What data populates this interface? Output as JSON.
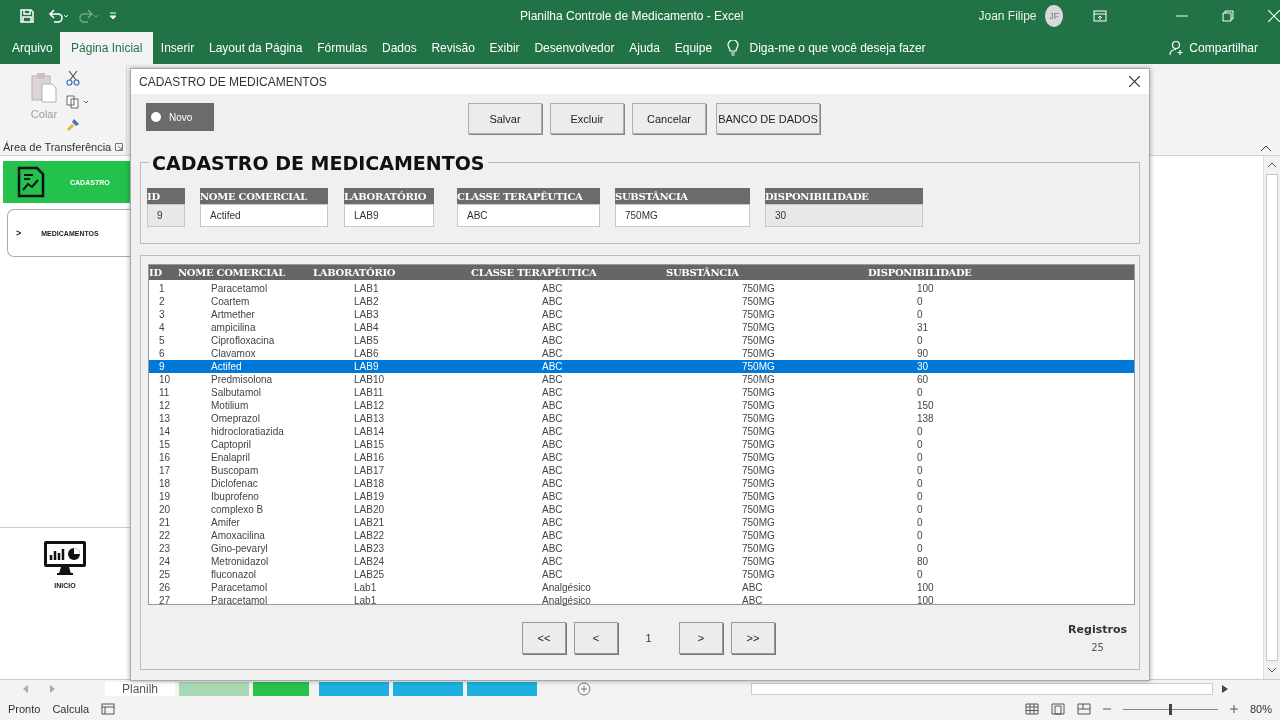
{
  "excel": {
    "title": "Planilha Controle de Medicamento  -  Excel",
    "user": "Joan Filipe",
    "avatar": "JF",
    "tabs": [
      {
        "label": "Arquivo",
        "selected": false
      },
      {
        "label": "Página Inicial",
        "selected": true
      },
      {
        "label": "Inserir",
        "selected": false
      },
      {
        "label": "Layout da Página",
        "selected": false
      },
      {
        "label": "Fórmulas",
        "selected": false
      },
      {
        "label": "Dados",
        "selected": false
      },
      {
        "label": "Revisão",
        "selected": false
      },
      {
        "label": "Exibir",
        "selected": false
      },
      {
        "label": "Desenvolvedor",
        "selected": false
      },
      {
        "label": "Ajuda",
        "selected": false
      },
      {
        "label": "Equipe",
        "selected": false
      }
    ],
    "tell_me": "Diga-me o que você deseja fazer",
    "share": "Compartilhar",
    "clipboard": {
      "paste": "Colar",
      "group": "Área de Transferência"
    },
    "sheet": {
      "cadastro": "CADASTRO",
      "arrow": ">",
      "medicamentos": "MEDICAMENTOS",
      "inicio": "INICIO"
    },
    "sheet_tabs": [
      {
        "label": "Planilh",
        "color": "#ffffff"
      },
      {
        "color": "#a9d9b4"
      },
      {
        "color": "#27c24c"
      },
      {
        "color": "#1eb0e0"
      },
      {
        "color": "#1eb0e0"
      },
      {
        "color": "#1eb0e0"
      }
    ],
    "status": {
      "ready": "Pronto",
      "calc": "Calcula",
      "zoom": "80%",
      "zoom_slider": {
        "level": 0.5
      }
    }
  },
  "dialog": {
    "title": "CADASTRO DE MEDICAMENTOS",
    "new_button": "Novo",
    "buttons": [
      "Salvar",
      "Excluir",
      "Cancelar",
      "BANCO DE DADOS"
    ],
    "heading": "CADASTRO DE MEDICAMENTOS",
    "fields": [
      {
        "label": "ID",
        "value": "9",
        "disabled": true
      },
      {
        "label": "NOME COMERCIAL",
        "value": "Actifed",
        "disabled": false
      },
      {
        "label": "LABORATÓRIO",
        "value": "LAB9",
        "disabled": false
      },
      {
        "label": "CLASSE TERAPÊUTICA",
        "value": "ABC",
        "disabled": false
      },
      {
        "label": "SUBSTÂNCIA",
        "value": "750MG",
        "disabled": false
      },
      {
        "label": "DISPONIBILIDADE",
        "value": "30",
        "disabled": true
      }
    ],
    "list": {
      "columns": [
        "ID",
        "NOME COMERCIAL",
        "LABORATÓRIO",
        "CLASSE TERAPÊUTICA",
        "SUBSTÂNCIA",
        "DISPONIBILIDADE"
      ],
      "rows": [
        {
          "cells": [
            "1",
            "Paracetamol",
            "LAB1",
            "ABC",
            "750MG",
            "100"
          ],
          "selected": false
        },
        {
          "cells": [
            "2",
            "Coartem",
            "LAB2",
            "ABC",
            "750MG",
            "0"
          ],
          "selected": false
        },
        {
          "cells": [
            "3",
            "Artmether",
            "LAB3",
            "ABC",
            "750MG",
            "0"
          ],
          "selected": false
        },
        {
          "cells": [
            "4",
            "ampicilina",
            "LAB4",
            "ABC",
            "750MG",
            "31"
          ],
          "selected": false
        },
        {
          "cells": [
            "5",
            "Ciprofloxacina",
            "LAB5",
            "ABC",
            "750MG",
            "0"
          ],
          "selected": false
        },
        {
          "cells": [
            "6",
            "Clavamox",
            "LAB6",
            "ABC",
            "750MG",
            "90"
          ],
          "selected": false
        },
        {
          "cells": [
            "9",
            "Actifed",
            "LAB9",
            "ABC",
            "750MG",
            "30"
          ],
          "selected": true
        },
        {
          "cells": [
            "10",
            "Predmisolona",
            "LAB10",
            "ABC",
            "750MG",
            "60"
          ],
          "selected": false
        },
        {
          "cells": [
            "11",
            "Salbutamol",
            "LAB11",
            "ABC",
            "750MG",
            "0"
          ],
          "selected": false
        },
        {
          "cells": [
            "12",
            "Motilium",
            "LAB12",
            "ABC",
            "750MG",
            "150"
          ],
          "selected": false
        },
        {
          "cells": [
            "13",
            "Omeprazol",
            "LAB13",
            "ABC",
            "750MG",
            "138"
          ],
          "selected": false
        },
        {
          "cells": [
            "14",
            "hidrocloratiazida",
            "LAB14",
            "ABC",
            "750MG",
            "0"
          ],
          "selected": false
        },
        {
          "cells": [
            "15",
            "Captopril",
            "LAB15",
            "ABC",
            "750MG",
            "0"
          ],
          "selected": false
        },
        {
          "cells": [
            "16",
            "Enalapril",
            "LAB16",
            "ABC",
            "750MG",
            "0"
          ],
          "selected": false
        },
        {
          "cells": [
            "17",
            "Buscopam",
            "LAB17",
            "ABC",
            "750MG",
            "0"
          ],
          "selected": false
        },
        {
          "cells": [
            "18",
            "Diclofenac",
            "LAB18",
            "ABC",
            "750MG",
            "0"
          ],
          "selected": false
        },
        {
          "cells": [
            "19",
            "Ibuprofeno",
            "LAB19",
            "ABC",
            "750MG",
            "0"
          ],
          "selected": false
        },
        {
          "cells": [
            "20",
            "complexo B",
            "LAB20",
            "ABC",
            "750MG",
            "0"
          ],
          "selected": false
        },
        {
          "cells": [
            "21",
            "Amifer",
            "LAB21",
            "ABC",
            "750MG",
            "0"
          ],
          "selected": false
        },
        {
          "cells": [
            "22",
            "Amoxacilina",
            "LAB22",
            "ABC",
            "750MG",
            "0"
          ],
          "selected": false
        },
        {
          "cells": [
            "23",
            "Gino-pevaryl",
            "LAB23",
            "ABC",
            "750MG",
            "0"
          ],
          "selected": false
        },
        {
          "cells": [
            "24",
            "Metronidazol",
            "LAB24",
            "ABC",
            "750MG",
            "80"
          ],
          "selected": false
        },
        {
          "cells": [
            "25",
            "fluconazol",
            "LAB25",
            "ABC",
            "750MG",
            "0"
          ],
          "selected": false
        },
        {
          "cells": [
            "26",
            "Paracetamol",
            "Lab1",
            "Analgésico",
            "ABC",
            "100"
          ],
          "selected": false
        },
        {
          "cells": [
            "27",
            "Paracetamol",
            "Lab1",
            "Analgésico",
            "ABC",
            "100"
          ],
          "selected": false
        }
      ]
    },
    "pager": {
      "first": "<<",
      "prev": "<",
      "page": "1",
      "next": ">",
      "last": ">>"
    },
    "records": {
      "label": "Registros",
      "value": "25"
    }
  }
}
